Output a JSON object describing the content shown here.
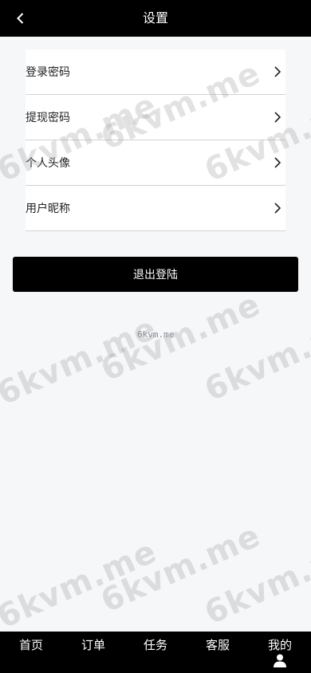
{
  "header": {
    "title": "设置"
  },
  "menu": {
    "items": [
      {
        "label": "登录密码"
      },
      {
        "label": "提现密码"
      },
      {
        "label": "个人头像"
      },
      {
        "label": "用户昵称"
      }
    ]
  },
  "logout_label": "退出登陆",
  "watermark": {
    "text": "6kvm.me",
    "small_text": "6kvm.me"
  },
  "tabbar": {
    "tabs": [
      {
        "label": "首页"
      },
      {
        "label": "订单"
      },
      {
        "label": "任务"
      },
      {
        "label": "客服"
      },
      {
        "label": "我的"
      }
    ]
  }
}
